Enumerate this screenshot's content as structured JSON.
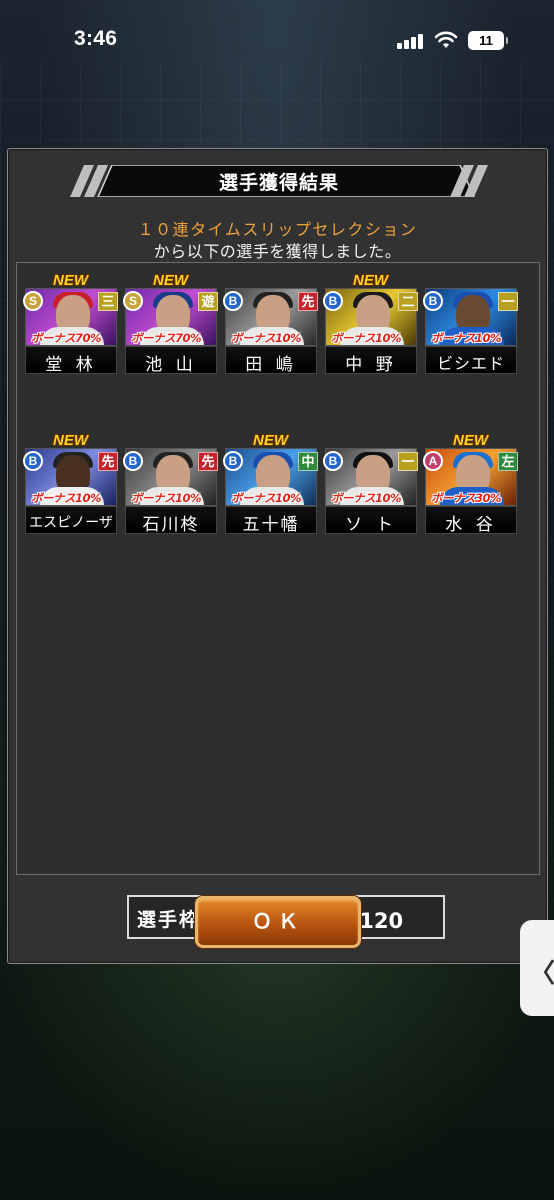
{
  "status_bar": {
    "time": "3:46",
    "battery": "11"
  },
  "dialog": {
    "title": "選手獲得結果",
    "message_line1": "１０連タイムスリップセレクション",
    "message_line2": "から以下の選手を獲得しました。",
    "cards": [
      {
        "name": "堂 林",
        "rank": "S",
        "position": "三",
        "bonus": "ボーナス70%",
        "new": "NEW"
      },
      {
        "name": "池 山",
        "rank": "S",
        "position": "遊",
        "bonus": "ボーナス70%",
        "new": "NEW"
      },
      {
        "name": "田 嶋",
        "rank": "B",
        "position": "先",
        "bonus": "ボーナス10%",
        "new": ""
      },
      {
        "name": "中 野",
        "rank": "B",
        "position": "二",
        "bonus": "ボーナス10%",
        "new": "NEW"
      },
      {
        "name": "ビシエド",
        "rank": "B",
        "position": "一",
        "bonus": "ボーナス10%",
        "new": ""
      },
      {
        "name": "エスピノーザ",
        "rank": "B",
        "position": "先",
        "bonus": "ボーナス10%",
        "new": "NEW"
      },
      {
        "name": "石川柊",
        "rank": "B",
        "position": "先",
        "bonus": "ボーナス10%",
        "new": ""
      },
      {
        "name": "五十幡",
        "rank": "B",
        "position": "中",
        "bonus": "ボーナス10%",
        "new": "NEW"
      },
      {
        "name": "ソ ト",
        "rank": "B",
        "position": "一",
        "bonus": "ボーナス10%",
        "new": ""
      },
      {
        "name": "水 谷",
        "rank": "A",
        "position": "左",
        "bonus": "ボーナス30%",
        "new": "NEW"
      }
    ],
    "slots_label": "選手枠：",
    "slots_value": "77／120",
    "ok_label": "ＯＫ"
  },
  "side_tab": {
    "label": "〈"
  },
  "colors": {
    "rank_S": "#c7a23a",
    "rank_A": "#c2416a",
    "rank_B": "#2467c8",
    "pos_infield_yellow": "#b8a021",
    "pos_pitcher_red": "#c4252d",
    "pos_infield_blue": "#2c6fcc",
    "pos_outfield_green": "#2f8a3d",
    "highlight_orange": "#f0a23a"
  }
}
